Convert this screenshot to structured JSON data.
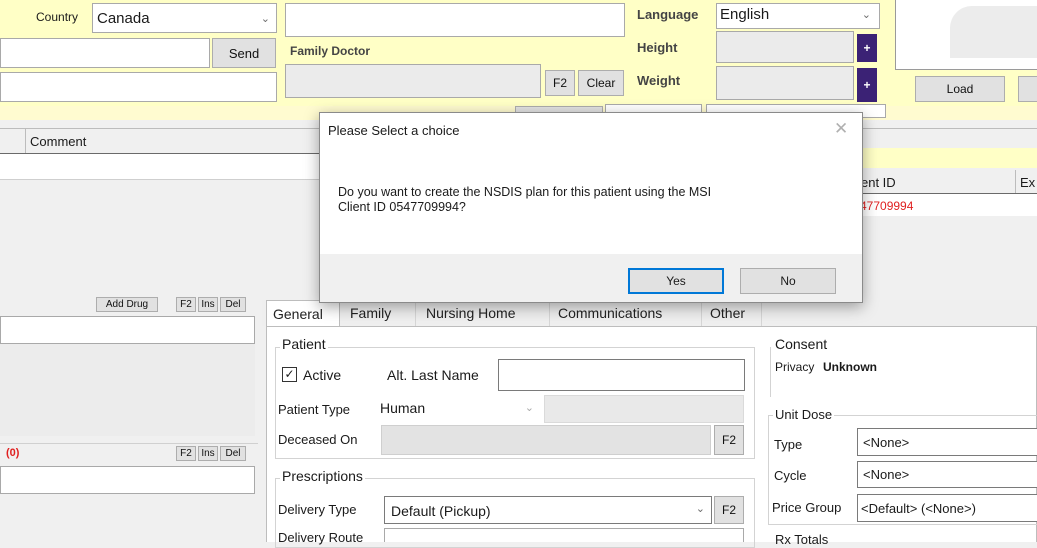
{
  "top": {
    "country_label": "Country",
    "country_value": "Canada",
    "send_label": "Send",
    "family_doctor_label": "Family Doctor",
    "f2_label": "F2",
    "clear_label": "Clear",
    "language_label": "Language",
    "language_value": "English",
    "height_label": "Height",
    "weight_label": "Weight",
    "plus_label": "+",
    "load_label": "Load",
    "comment_header": "Comment"
  },
  "ids_table": {
    "header_client_id": "ent ID",
    "header_exp": "Ex",
    "row_client_id": "47709994"
  },
  "drugs": {
    "add_drug_label": "Add Drug",
    "f2": "F2",
    "ins": "Ins",
    "del": "Del",
    "count_label": "(0)"
  },
  "tabs": [
    {
      "label": "General"
    },
    {
      "label": "Family"
    },
    {
      "label": "Nursing Home"
    },
    {
      "label": "Communications"
    },
    {
      "label": "Other"
    }
  ],
  "patient": {
    "group_label": "Patient",
    "active_label": "Active",
    "active_checked": true,
    "alt_last_name_label": "Alt. Last Name",
    "patient_type_label": "Patient Type",
    "patient_type_value": "Human",
    "deceased_on_label": "Deceased On",
    "f2": "F2"
  },
  "prescriptions": {
    "group_label": "Prescriptions",
    "delivery_type_label": "Delivery Type",
    "delivery_type_value": "Default (Pickup)",
    "delivery_route_label": "Delivery Route",
    "f2": "F2"
  },
  "consent": {
    "group_label": "Consent",
    "privacy_label": "Privacy",
    "privacy_value": "Unknown"
  },
  "unit_dose": {
    "group_label": "Unit Dose",
    "type_label": "Type",
    "type_value": "<None>",
    "cycle_label": "Cycle",
    "cycle_value": "<None>",
    "price_group_label": "Price Group",
    "price_group_value": "<Default> (<None>)",
    "rx_totals_label": "Rx Totals"
  },
  "dialog": {
    "title": "Please Select a choice",
    "message_line1": "Do you want to create the NSDIS plan for this patient using the MSI",
    "message_line2": "Client ID 0547709994?",
    "yes_label": "Yes",
    "no_label": "No"
  },
  "colors": {
    "highlight_yellow": "#ffffc6",
    "accent_purple": "#3b2275",
    "id_red": "#e02020",
    "focus_blue": "#0078d7"
  }
}
